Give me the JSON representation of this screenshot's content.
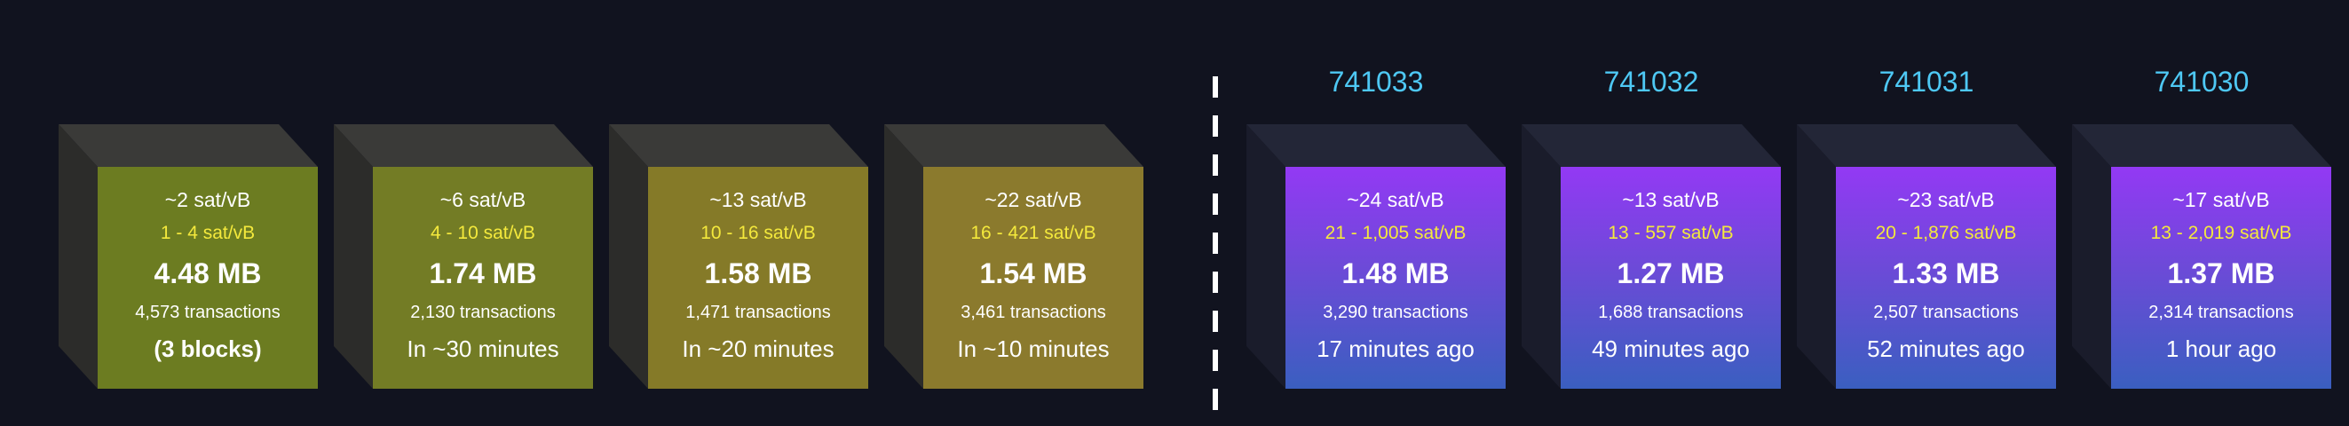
{
  "mempool_blocks": [
    {
      "median_fee": "~2 sat/vB",
      "fee_range": "1 - 4 sat/vB",
      "size": "4.48 MB",
      "transactions": "4,573 transactions",
      "eta": "(3 blocks)",
      "color": "#6c7c21"
    },
    {
      "median_fee": "~6 sat/vB",
      "fee_range": "4 - 10 sat/vB",
      "size": "1.74 MB",
      "transactions": "2,130 transactions",
      "eta": "In ~30 minutes",
      "color": "#737c25"
    },
    {
      "median_fee": "~13 sat/vB",
      "fee_range": "10 - 16 sat/vB",
      "size": "1.58 MB",
      "transactions": "1,471 transactions",
      "eta": "In ~20 minutes",
      "color": "#857a28"
    },
    {
      "median_fee": "~22 sat/vB",
      "fee_range": "16 - 421 sat/vB",
      "size": "1.54 MB",
      "transactions": "3,461 transactions",
      "eta": "In ~10 minutes",
      "color": "#8b7a2d"
    }
  ],
  "mined_blocks": [
    {
      "height": "741033",
      "median_fee": "~24 sat/vB",
      "fee_range": "21 - 1,005 sat/vB",
      "size": "1.48 MB",
      "transactions": "3,290 transactions",
      "age": "17 minutes ago"
    },
    {
      "height": "741032",
      "median_fee": "~13 sat/vB",
      "fee_range": "13 - 557 sat/vB",
      "size": "1.27 MB",
      "transactions": "1,688 transactions",
      "age": "49 minutes ago"
    },
    {
      "height": "741031",
      "median_fee": "~23 sat/vB",
      "fee_range": "20 - 1,876 sat/vB",
      "size": "1.33 MB",
      "transactions": "2,507 transactions",
      "age": "52 minutes ago"
    },
    {
      "height": "741030",
      "median_fee": "~17 sat/vB",
      "fee_range": "13 - 2,019 sat/vB",
      "size": "1.37 MB",
      "transactions": "2,314 transactions",
      "age": "1 hour ago"
    }
  ]
}
